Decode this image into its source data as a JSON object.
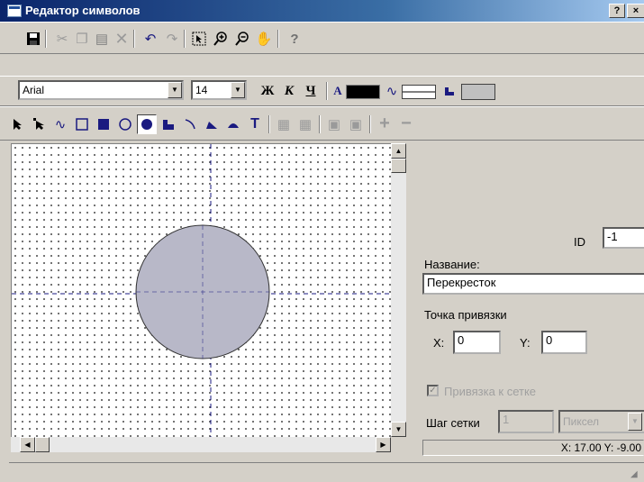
{
  "window": {
    "title": "Редактор символов",
    "help_btn": "?",
    "close_btn": "×"
  },
  "toolbar1": {
    "icons": [
      "save-icon",
      "cut-icon",
      "copy-icon",
      "paste-icon",
      "delete-icon",
      "undo-icon",
      "redo-icon",
      "select-zoom-icon",
      "zoom-in-icon",
      "zoom-out-icon",
      "pan-hand-icon",
      "help-icon"
    ]
  },
  "toolbar2": {
    "font": "Arial",
    "size": "14",
    "bold_label": "Ж",
    "italic_label": "К",
    "underline_label": "Ч",
    "text_color_label": "A",
    "fill_color": "#000000",
    "line_color": "#c0c0c0"
  },
  "toolbar3": {
    "text_tool_label": "T",
    "add_label": "+",
    "remove_label": "−"
  },
  "panel": {
    "id_label": "ID",
    "id_value": "-1",
    "name_label": "Название:",
    "name_value": "Перекресток",
    "anchor_label": "Точка привязки",
    "x_label": "X:",
    "x_value": "0",
    "y_label": "Y:",
    "y_value": "0",
    "snap_label": "Привязка к сетке",
    "grid_step_label": "Шаг сетки",
    "grid_step_value": "1",
    "grid_unit": "Пиксел",
    "coords": "X: 17.00 Y: -9.00"
  },
  "colors": {
    "circle_fill": "#b8b8c8",
    "crosshair": "#1a1a80"
  }
}
